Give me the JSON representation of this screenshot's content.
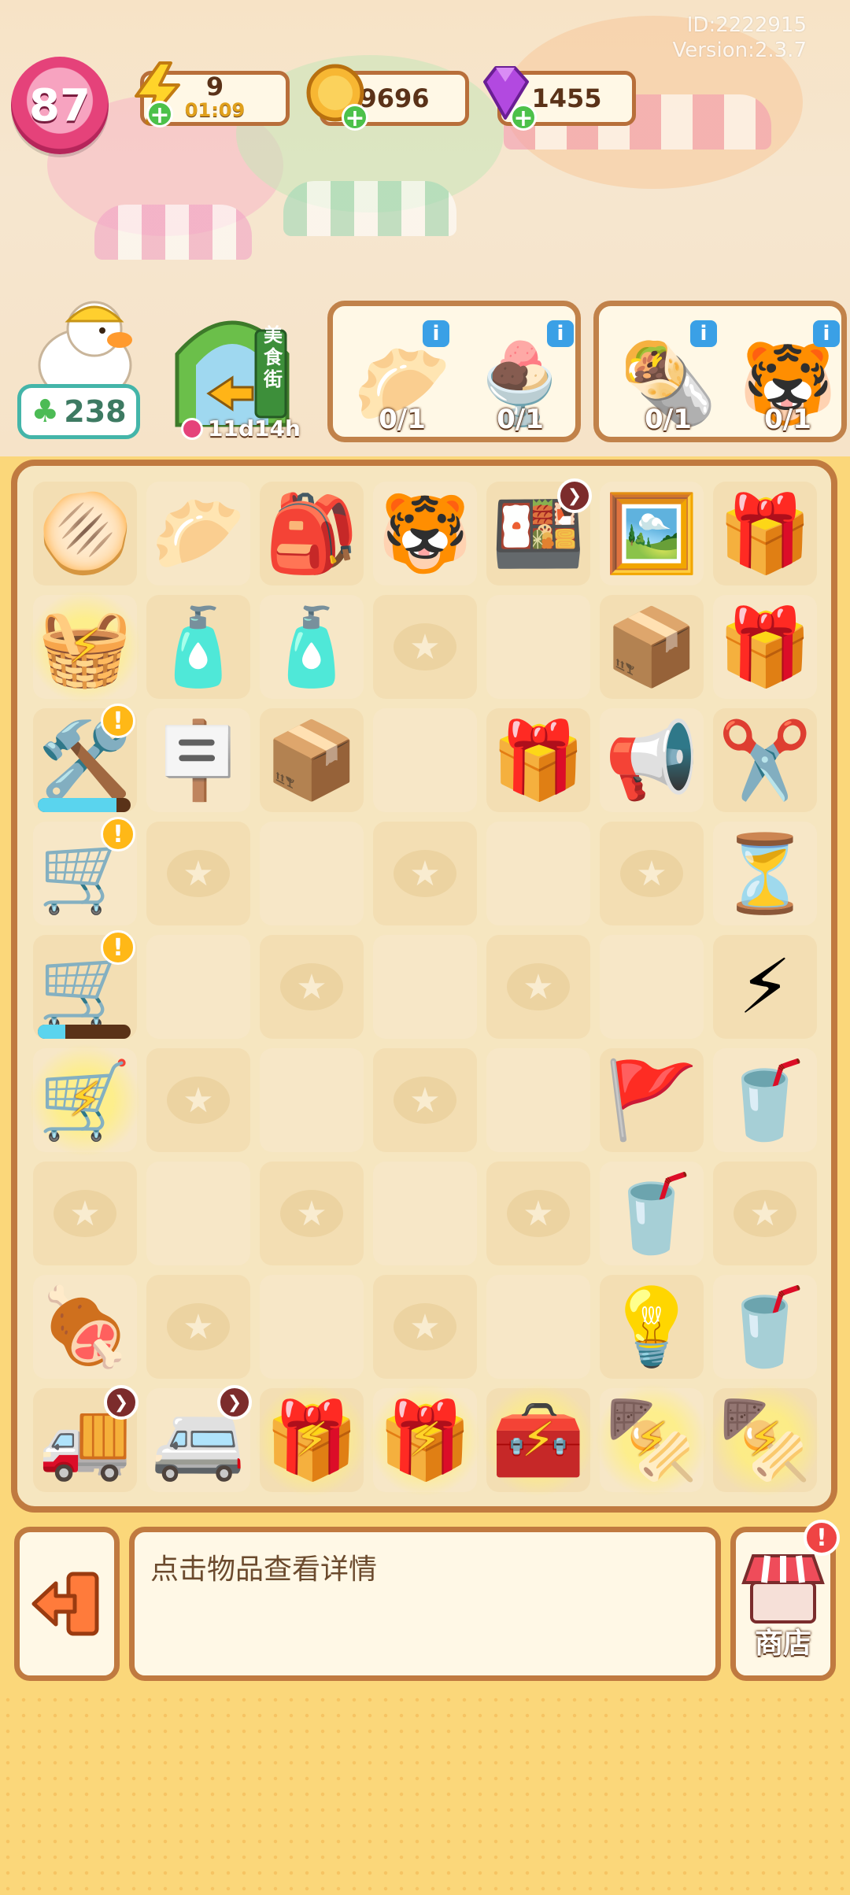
{
  "hud": {
    "player_id": "ID:2222915",
    "version": "Version:2.3.7",
    "level": "87",
    "energy": {
      "value": "9",
      "timer": "01:09",
      "icon": "lightning-icon"
    },
    "coins": {
      "value": "9696",
      "icon": "coin-icon"
    },
    "gems": {
      "value": "1455",
      "icon": "gem-icon"
    }
  },
  "clover": {
    "value": "238",
    "icon": "clover-icon"
  },
  "event": {
    "timer": "11d14h",
    "sign_text": "美食街"
  },
  "orders": [
    {
      "items": [
        {
          "name": "dough",
          "count": "0/1"
        },
        {
          "name": "ice-cream-sundae",
          "count": "0/1"
        }
      ]
    },
    {
      "items": [
        {
          "name": "wrap",
          "count": "0/1"
        },
        {
          "name": "tiger-plush",
          "count": "0/1"
        }
      ]
    }
  ],
  "board": {
    "rows": [
      [
        "flatbread",
        "white-bun",
        "green-bag",
        "tiger-plush",
        "bento-box",
        "photo-card",
        "gift-box-pink"
      ],
      [
        "energy-basket",
        "gas-can",
        "gas-can",
        "empty",
        "blank",
        "bento-open",
        "gift-box-blue"
      ],
      [
        "drill-cart",
        "open-sign",
        "boxes",
        "blank",
        "gift-box-blue",
        "megaphone",
        "scissors-bubble"
      ],
      [
        "ice-cream-cart",
        "empty",
        "blank",
        "empty",
        "blank",
        "empty",
        "hourglass-bubble"
      ],
      [
        "ice-cream-cart",
        "blank",
        "empty",
        "blank",
        "empty",
        "blank",
        "energy-bubble"
      ],
      [
        "energy-cart",
        "empty",
        "blank",
        "empty",
        "blank",
        "bunting",
        "sundae-cup"
      ],
      [
        "empty",
        "blank",
        "empty",
        "blank",
        "empty",
        "sundae-cup",
        "empty"
      ],
      [
        "grill",
        "empty",
        "blank",
        "empty",
        "blank",
        "string-lights",
        "sundae-cup"
      ],
      [
        "delivery-truck",
        "food-truck",
        "energy-present",
        "energy-present",
        "energy-toolbox",
        "energy-bbq",
        "energy-bbq"
      ]
    ]
  },
  "bottom": {
    "description": "点击物品查看详情",
    "shop_label": "商店",
    "exit_icon": "exit-icon",
    "shop_icon": "shop-icon"
  }
}
